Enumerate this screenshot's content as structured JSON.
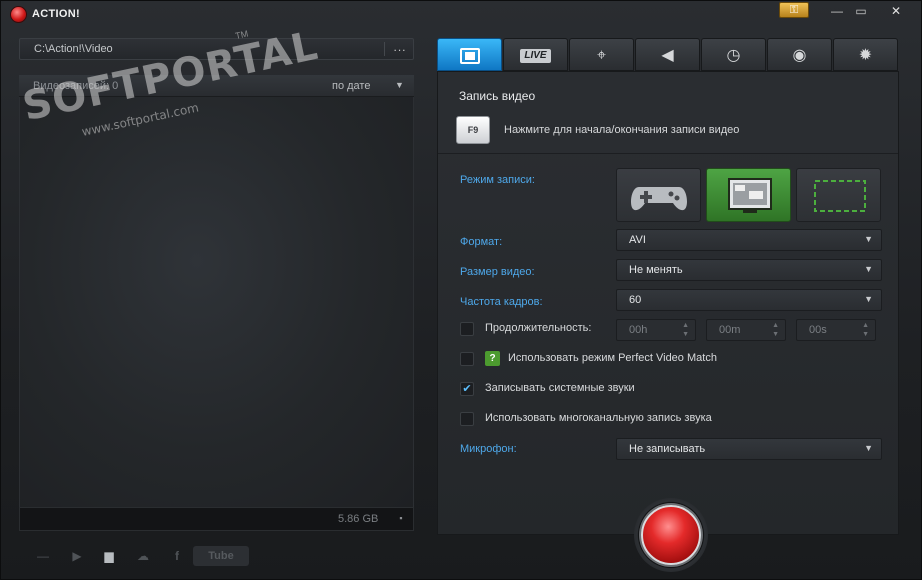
{
  "app": {
    "title": "ACTION!",
    "key_icon": "key-icon"
  },
  "window_controls": {
    "minimize": "—",
    "maximize": "▭",
    "close": "✕"
  },
  "left": {
    "path": "C:\\Action!\\Video",
    "browse_label": "...",
    "video_count_label": "Видеозаписей: 0",
    "sort_label": "по дате",
    "disk_free": "5.86 GB"
  },
  "bottom_tools": [
    "minus-icon",
    "play-icon",
    "folder-icon",
    "upload-icon",
    "facebook-icon",
    "youtube-button"
  ],
  "youtube_label": "Tube",
  "tabs": [
    {
      "name": "video",
      "icon": "film-icon",
      "active": true
    },
    {
      "name": "live",
      "label": "LIVE",
      "active": false
    },
    {
      "name": "game",
      "icon": "gamepad-icon",
      "active": false
    },
    {
      "name": "audio",
      "icon": "speaker-icon",
      "active": false
    },
    {
      "name": "timer",
      "icon": "stopwatch-icon",
      "active": false
    },
    {
      "name": "screenshot",
      "icon": "camera-icon",
      "active": false
    },
    {
      "name": "settings",
      "icon": "gear-icon",
      "active": false
    }
  ],
  "panel": {
    "title": "Запись видео",
    "hotkey": "F9",
    "hotkey_hint": "Нажмите для начала/окончания записи видео"
  },
  "settings": {
    "mode_label": "Режим записи:",
    "mode_active": "desktop",
    "format_label": "Формат:",
    "format_value": "AVI",
    "size_label": "Размер видео:",
    "size_value": "Не менять",
    "fps_label": "Частота кадров:",
    "fps_value": "60",
    "duration_label": "Продолжительность:",
    "duration_hours": "00h",
    "duration_minutes": "00m",
    "duration_seconds": "00s",
    "pvm_label": "Использовать режим Perfect Video Match",
    "system_sound_label": "Записывать системные звуки",
    "multichannel_label": "Использовать многоканальную запись звука",
    "mic_label": "Микрофон:",
    "mic_value": "Не записывать"
  },
  "checks": {
    "duration": false,
    "pvm": false,
    "system_sound": true,
    "multichannel": false
  },
  "watermark": {
    "main": "SOFTPORTAL",
    "tm": "TM",
    "sub": "www.softportal.com"
  },
  "colors": {
    "accent_blue": "#2796e0",
    "label_blue": "#4ea8ea",
    "record_red": "#e42a2a",
    "active_mode_green": "#4ea444"
  }
}
